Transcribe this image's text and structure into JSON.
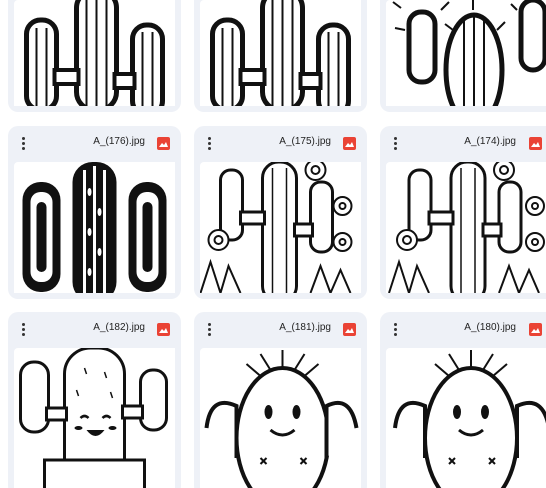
{
  "files": [
    {
      "name": "",
      "thumb": "cactus-outline-icon"
    },
    {
      "name": "",
      "thumb": "cactus-outline-icon"
    },
    {
      "name": "",
      "thumb": "cactus-spiky-icon"
    },
    {
      "name": "A_(176).jpg",
      "thumb": "cactus-black-icon"
    },
    {
      "name": "A_(175).jpg",
      "thumb": "cactus-flowers-icon"
    },
    {
      "name": "A_(174).jpg",
      "thumb": "cactus-flowers-icon"
    },
    {
      "name": "A_(182).jpg",
      "thumb": "cactus-smiling-pot-icon"
    },
    {
      "name": "A_(181).jpg",
      "thumb": "cactus-smiling-icon"
    },
    {
      "name": "A_(180).jpg",
      "thumb": "cactus-smiling-icon"
    }
  ],
  "colors": {
    "card_bg": "#eef1f7",
    "image_icon": "#ea4335"
  }
}
